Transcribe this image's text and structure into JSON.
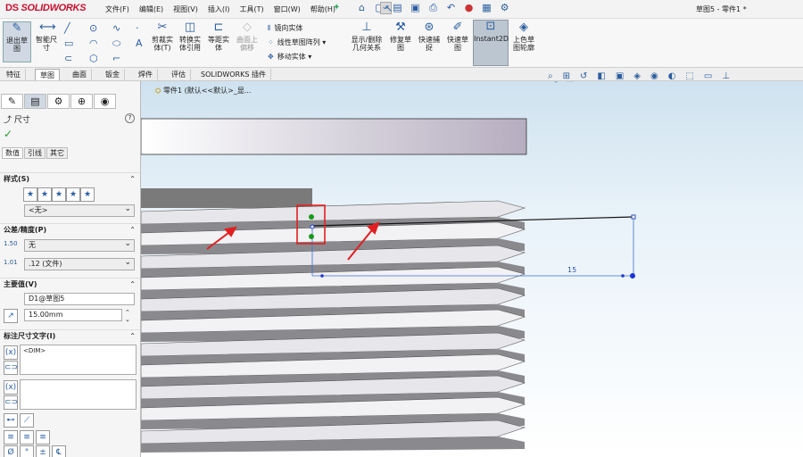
{
  "app": {
    "logo": "SOLIDWORKS",
    "logo_prefix": "DS",
    "doc_title": "草图5 - 零件1 *"
  },
  "menu": [
    "文件(F)",
    "编辑(E)",
    "视图(V)",
    "插入(I)",
    "工具(T)",
    "窗口(W)",
    "帮助(H)"
  ],
  "ribbon": {
    "exit_sketch": "退出草图",
    "smart_dim": "智能尺寸",
    "trim": "剪裁实体(T)",
    "convert": "转换实体引用",
    "offset": "等距实体",
    "offset_surface": "曲面上偏移",
    "mirror": "镜向实体",
    "linear_pattern": "线性草图阵列",
    "move": "移动实体",
    "display_relations": "显示/删除几何关系",
    "repair": "修复草图",
    "quick_snaps": "快速捕捉",
    "rapid_sketch": "快速草图",
    "instant2d": "Instant2D",
    "shaded_contours": "上色草图轮廓"
  },
  "tabs": [
    "特征",
    "草图",
    "曲面",
    "钣金",
    "焊件",
    "评估",
    "SOLIDWORKS 插件"
  ],
  "active_tab": "草图",
  "tree_item": "零件1 (默认<<默认>_显...",
  "panel": {
    "title": "尺寸",
    "help": "?",
    "ok": "✓",
    "subtabs": [
      "数值",
      "引线",
      "其它"
    ],
    "style_label": "样式(S)",
    "style_value": "<无>",
    "tolerance_label": "公差/精度(P)",
    "tolerance_value": "无",
    "precision_value": ".12 (文件)",
    "primary_label": "主要值(V)",
    "primary_name": "D1@草图5",
    "primary_value": "15.00mm",
    "dimtext_label": "标注尺寸文字(I)",
    "dimtext_value": "<DIM>"
  },
  "dimension": {
    "value": "15"
  },
  "colors": {
    "highlight": "#e02020",
    "accent": "#2a5d9f",
    "dim_line": "#2a4fb0",
    "relation": "#1a9a1a"
  }
}
